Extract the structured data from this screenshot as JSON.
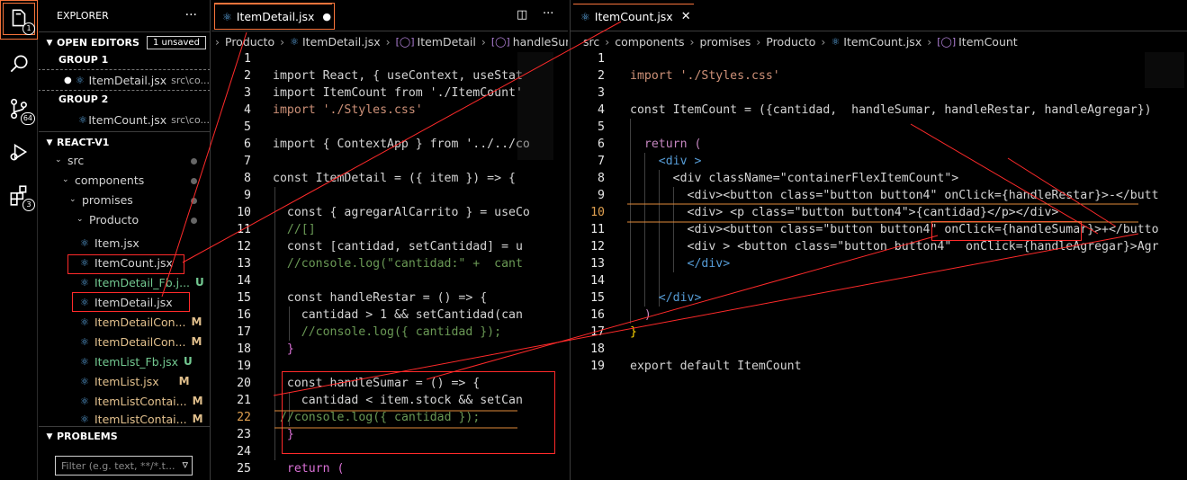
{
  "activity": {
    "explorer_badge": "1",
    "scm_badge": "64",
    "ext_badge": "3"
  },
  "explorer": {
    "title": "EXPLORER",
    "more": "···",
    "open_editors": {
      "label": "OPEN EDITORS",
      "badge": "1 unsaved"
    },
    "group1": "GROUP 1",
    "group1_item": {
      "name": "ItemDetail.jsx",
      "path": "src\\co..."
    },
    "group2": "GROUP 2",
    "group2_item": {
      "name": "ItemCount.jsx",
      "path": "src\\co..."
    },
    "project": "REACT-V1",
    "tree": {
      "src": "src",
      "components": "components",
      "promises": "promises",
      "producto": "Producto",
      "files": [
        {
          "name": "Item.jsx",
          "status": ""
        },
        {
          "name": "ItemCount.jsx",
          "status": ""
        },
        {
          "name": "ItemDetail_Fb.j...",
          "status": "U"
        },
        {
          "name": "ItemDetail.jsx",
          "status": ""
        },
        {
          "name": "ItemDetailCon...",
          "status": "M"
        },
        {
          "name": "ItemDetailCon...",
          "status": "M"
        },
        {
          "name": "ItemList_Fb.jsx",
          "status": "U"
        },
        {
          "name": "ItemList.jsx",
          "status": "M"
        },
        {
          "name": "ItemListContai...",
          "status": "M"
        },
        {
          "name": "ItemListContai...",
          "status": "M"
        }
      ]
    },
    "problems": "PROBLEMS",
    "filter_placeholder": "Filter (e.g. text, **/*.t..."
  },
  "left_editor": {
    "tab": "ItemDetail.jsx",
    "breadcrumb": [
      "Producto",
      "ItemDetail.jsx",
      "ItemDetail",
      "handleSumar"
    ],
    "lines": [
      {
        "n": "1",
        "code": ""
      },
      {
        "n": "2",
        "code": "import React, { useContext, useStat"
      },
      {
        "n": "3",
        "code": "import ItemCount from './ItemCount'"
      },
      {
        "n": "4",
        "code": "import './Styles.css'"
      },
      {
        "n": "5",
        "code": ""
      },
      {
        "n": "6",
        "code": "import { ContextApp } from '../../co"
      },
      {
        "n": "7",
        "code": ""
      },
      {
        "n": "8",
        "code": "const ItemDetail = ({ item }) => {"
      },
      {
        "n": "9",
        "code": ""
      },
      {
        "n": "10",
        "code": "  const { agregarAlCarrito } = useCo"
      },
      {
        "n": "11",
        "code": "  //[]"
      },
      {
        "n": "12",
        "code": "  const [cantidad, setCantidad] = u"
      },
      {
        "n": "13",
        "code": "  //console.log(\"cantidad:\" +  cant"
      },
      {
        "n": "14",
        "code": ""
      },
      {
        "n": "15",
        "code": "  const handleRestar = () => {"
      },
      {
        "n": "16",
        "code": "    cantidad > 1 && setCantidad(can"
      },
      {
        "n": "17",
        "code": "    //console.log({ cantidad });"
      },
      {
        "n": "18",
        "code": "  }"
      },
      {
        "n": "19",
        "code": ""
      },
      {
        "n": "20",
        "code": "  const handleSumar = () => {"
      },
      {
        "n": "21",
        "code": "    cantidad < item.stock && setCan"
      },
      {
        "n": "22",
        "code": "//console.log({ cantidad });"
      },
      {
        "n": "23",
        "code": "  }"
      },
      {
        "n": "24",
        "code": ""
      },
      {
        "n": "25",
        "code": "  return ("
      }
    ]
  },
  "right_editor": {
    "tab": "ItemCount.jsx",
    "breadcrumb": [
      "src",
      "components",
      "promises",
      "Producto",
      "ItemCount.jsx",
      "ItemCount"
    ],
    "lines": [
      {
        "n": "1",
        "code": ""
      },
      {
        "n": "2",
        "code": "import './Styles.css'"
      },
      {
        "n": "3",
        "code": ""
      },
      {
        "n": "4",
        "code": "const ItemCount = ({cantidad,  handleSumar, handleRestar, handleAgregar})"
      },
      {
        "n": "5",
        "code": ""
      },
      {
        "n": "6",
        "code": "  return ("
      },
      {
        "n": "7",
        "code": "    <div >"
      },
      {
        "n": "8",
        "code": "      <div className=\"containerFlexItemCount\">"
      },
      {
        "n": "9",
        "code": "        <div><button class=\"button button4\" onClick={handleRestar}>-</butt"
      },
      {
        "n": "10",
        "code": "        <div> <p class=\"button button4\">{cantidad}</p></div>"
      },
      {
        "n": "11",
        "code": "        <div><button class=\"button button4\" onClick={handleSumar}>+</butto"
      },
      {
        "n": "12",
        "code": "        <div > <button class=\"button button4\"  onClick={handleAgregar}>Agr"
      },
      {
        "n": "13",
        "code": "        </div>"
      },
      {
        "n": "14",
        "code": ""
      },
      {
        "n": "15",
        "code": "    </div>"
      },
      {
        "n": "16",
        "code": "  )"
      },
      {
        "n": "17",
        "code": "}"
      },
      {
        "n": "18",
        "code": ""
      },
      {
        "n": "19",
        "code": "export default ItemCount"
      }
    ]
  },
  "colors": {
    "annotation": "#ff2a2a",
    "background": "#000000",
    "keyword": "#c586c0",
    "string": "#ce9178"
  }
}
